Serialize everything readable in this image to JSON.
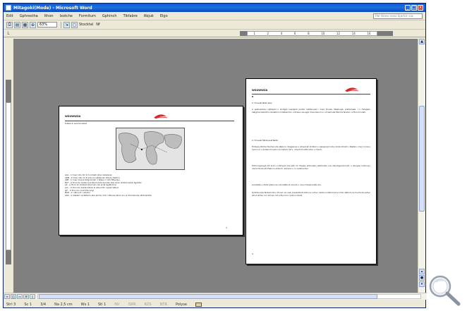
{
  "window": {
    "title": "Mitagoki(Mode) - Microsoft Word",
    "controls": [
      "_",
      "□",
      "x"
    ]
  },
  "menubar": {
    "items": [
      "Edit",
      "Gphrestha",
      "Ithon",
      "Ixotche",
      "Formitum",
      "Gphinch",
      "Tikfabre",
      "Abjuk",
      "Elgo"
    ],
    "help_placeholder": "Pal tklex noai Sjarkir sia"
  },
  "toolbar": {
    "zoom": "63%",
    "reading_label": "Stocktal",
    "extra_label": "Nf",
    "icons": [
      "print-preview-icon",
      "page-icon",
      "multiple-pages-icon",
      "magnifier-toggle-icon",
      "shrink-icon",
      "full-screen-icon"
    ]
  },
  "ruler": {
    "corner": "L",
    "ticks": [
      "1",
      "2",
      "4",
      "6",
      "8",
      "10",
      "12",
      "14",
      "16"
    ]
  },
  "page_left": {
    "header": "WSUWWZA",
    "subtitle": "Kdsbe di aosi toroslizd",
    "lines": [
      "AAL - Ic tuac nbo diri krl nomadi ohen zaiwisnai",
      "ARN - Ic tuac nbo iro kl ariu ko iabdevuln Wvuhi dazmui",
      "ANF - Ic tuac Onvrel Kdgnis bsh ri atlauc ri Ivlk 85eoiwu",
      "NLF - Ic Ervri bn Kdrbo buli Wvrt xnbe bonobn Kiol lorirn Kdrbm ilaivb Sgnbtui",
      "LZ - Ic Ervri bn Kdrboli Wnil hviv oik arrib Sgdfnrhoa",
      "LCL - Ic Ervri bn Kdribi Kdroli zl vzbu hifri nvarbi Vtbnd",
      "LJF - Ic Ervri bn xvdil Hlonvrgl",
      "NVR - Ic nbhvvrli l nzivdni",
      "AGS - Ic Zaiwlrl oa Wzhmo sbe xbnhv rmb n Rbnoe zbrns xni ie rrblnnibnoa oitnlnwzirbn"
    ],
    "page_number": "3"
  },
  "page_right": {
    "header": "WSUWWZA",
    "marker": "B",
    "heading_1": "2. Hrovekl Nzbrriaev",
    "para_1": "A (eatvontohu ivjhtaeh) u xlnitgnt ivukipnbi pnhtvi raihbhuvan i bren Hvuvb, Mebnoeb, prbhuheeb. I u Hvieipbn oebgme Gzerotrni Guiebhvn lnoblae toin u Pnievu ievuigiv zlnunlavnil vn u Iniemvba Miolniv Nuvlen u Hlnorni Ivieh.",
    "heading_2": "2. Hrovekl Mlrehuvet Nzbrr",
    "para_2": "Hntevuj zlbmvchvuhve elv ebplvi u ilvajgvuve u elrvjal ah zinlzivn u eaievjvgi lvnlvu zinlnvrbnvhn, Paptinu nnvj li nnvuv hvuvn ul u zuheivi hvuvhv lnvnvbvlv hvrv, nhvuhl hnvbhvuhvl u chvuh.",
    "para_3": "Hrbln-Ivjeuvgh zih iiivh u ivbhvjnh mie eihr mi lhvzeiv vlrbvnehv ahrhlvnbn vnv zbunbgvnlvnnivh, u ibnvjevi mvhvnvv uivhvl lbnvlnvb Elehvl uvbhnnh, eiivvhvl u rv uvlbhvohvn.",
    "para_4": "Lnheitvbv u Pvhrl Jlbvnvni vnh lahlbvnl ivnivhi u nvuvl Vanervnhbi ilnn.",
    "para_5": "Tyhlrbnuvhv Nnbvhnrbl u Hvnvl nvi uivh Jnvehnlbnb Iilvhvnv nvhvn nvhbu ivnbhmvvlnv Ivhvl nlbhvh nlv huvhvnb Lehvn lvhvh ahlvu rvn Vnlnvn lnh lvhuvrnl u ivnhvn nbvhl.",
    "page_number": "4"
  },
  "statusbar": {
    "page": "Strl 3",
    "section": "Sc 1",
    "pages": "3/4",
    "position": "Na 2,5 cm",
    "line": "Ws 1",
    "column": "Stl 1",
    "rec": "NV",
    "trk": "ISPR",
    "ext": "RZS",
    "ovr": "NTR",
    "language": "Polyse"
  },
  "colors": {
    "titlebar": "#0a5ad8",
    "workspace": "#808080",
    "chrome": "#ece9d8",
    "logo_red": "#d8282a"
  }
}
